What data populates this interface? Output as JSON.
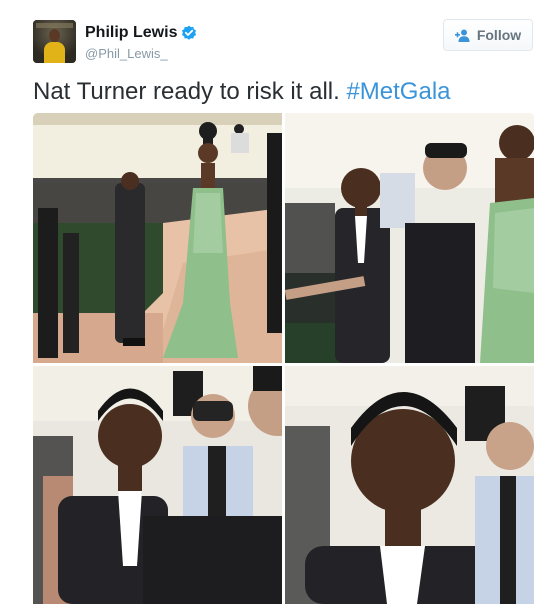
{
  "user": {
    "display_name": "Philip Lewis",
    "handle": "@Phil_Lewis_",
    "verified": true,
    "avatar_icon": "profile-avatar"
  },
  "actions": {
    "follow_label": "Follow",
    "follow_icon": "add-user-icon"
  },
  "tweet": {
    "text": "Nat Turner ready to risk it all. ",
    "hashtag": "#MetGala"
  },
  "media": {
    "photo_count": 4
  },
  "colors": {
    "link": "#3b94d9",
    "name": "#14171a",
    "muted": "#8899a6",
    "verified": "#1da1f2",
    "gown": "#8fbf8a"
  }
}
